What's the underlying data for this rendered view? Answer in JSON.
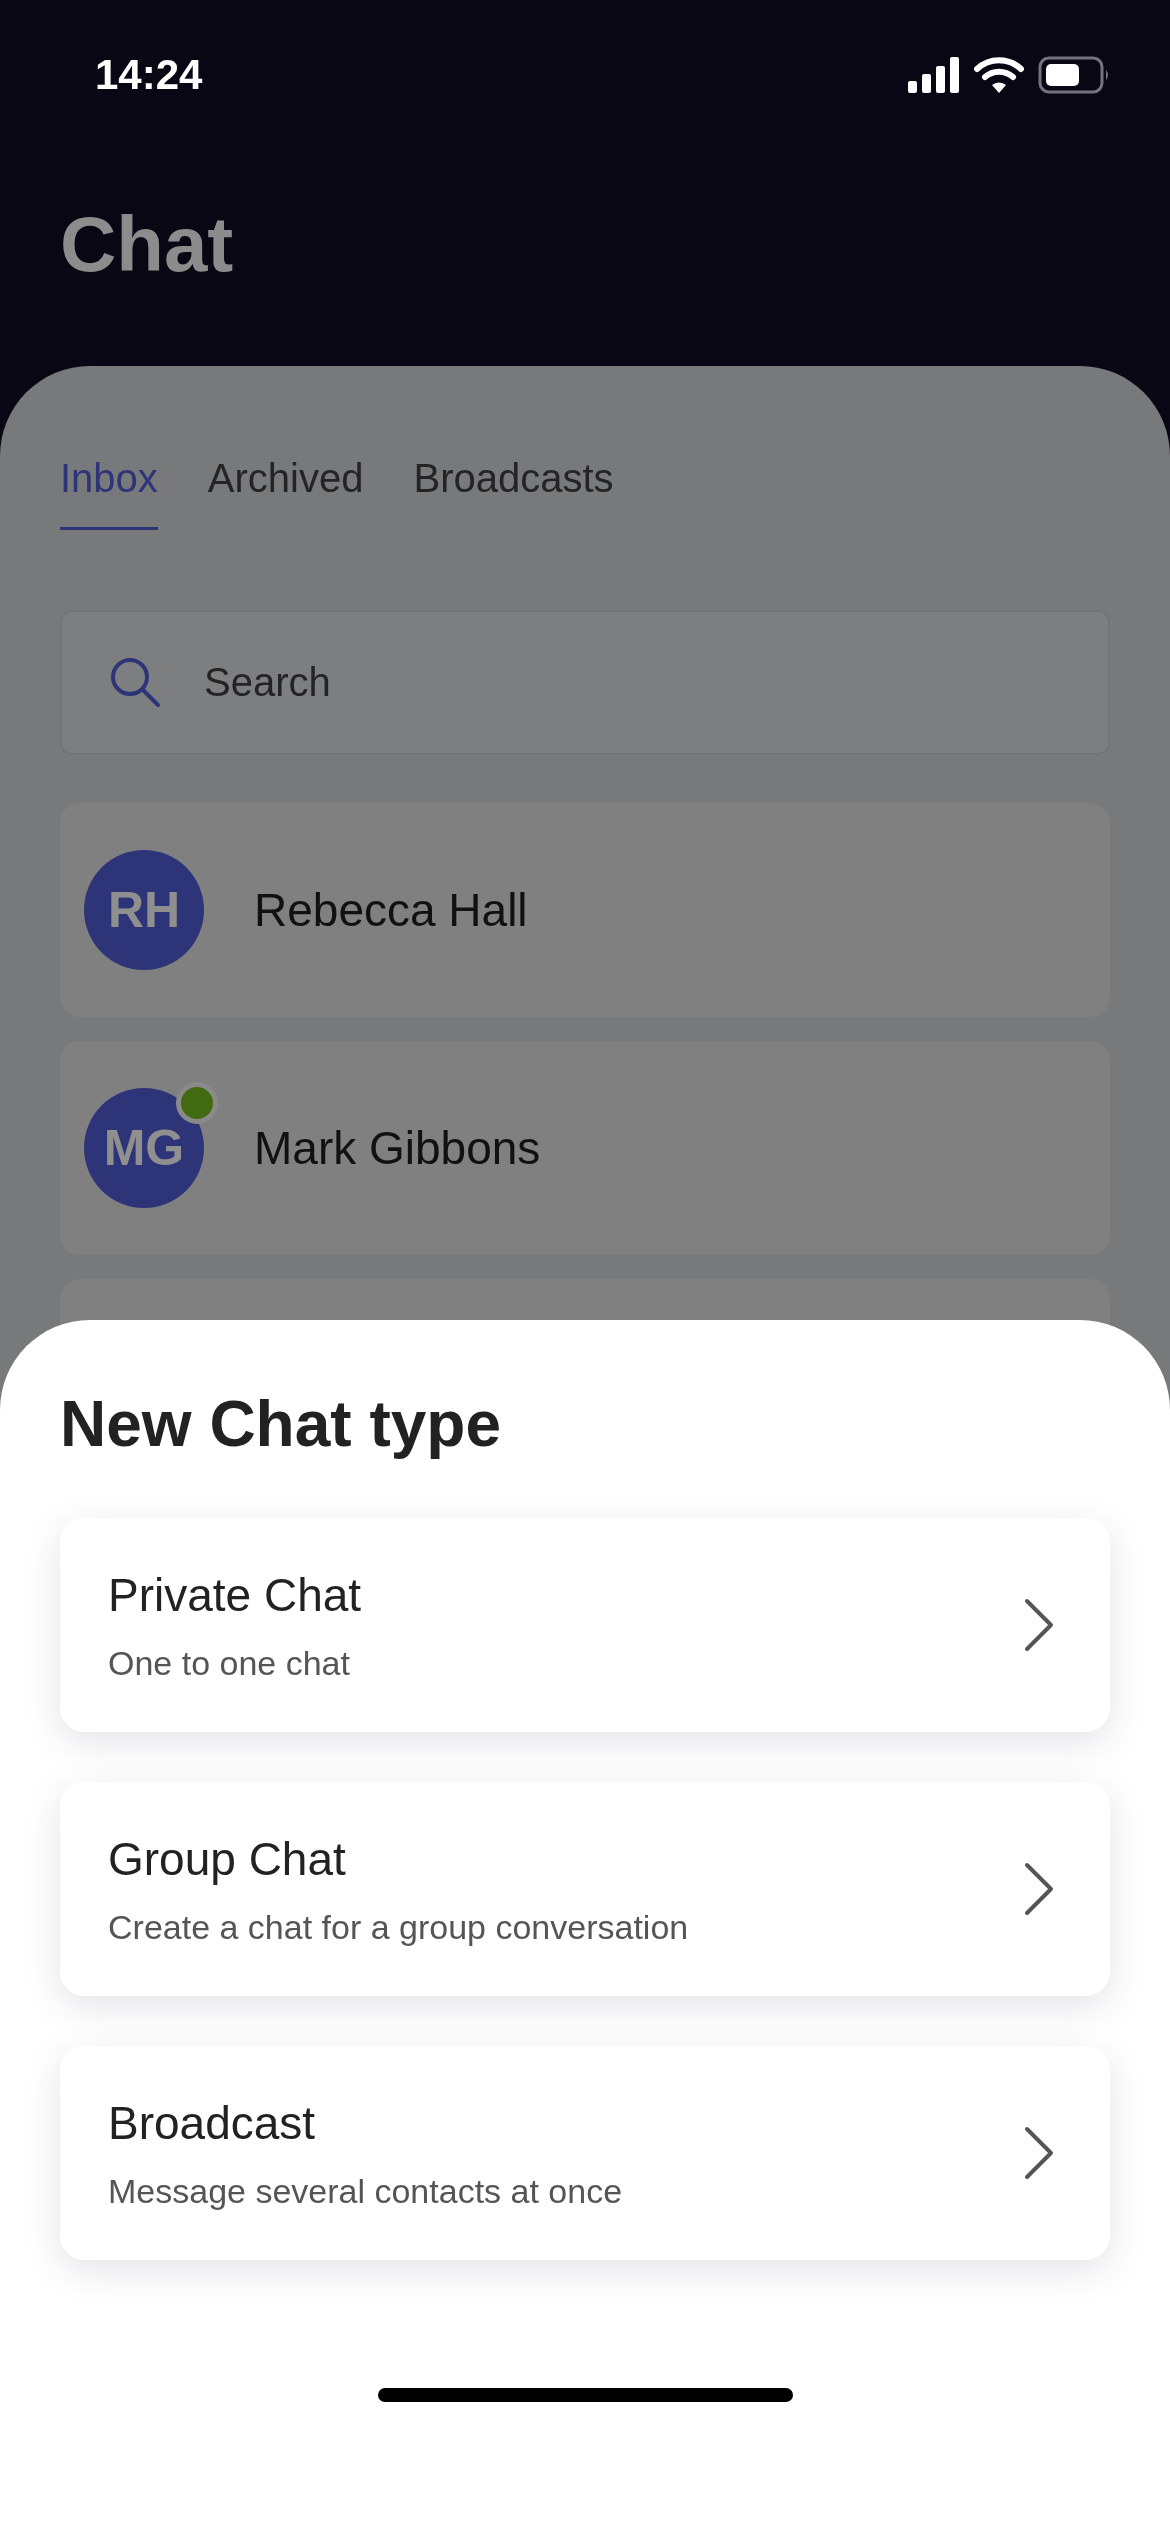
{
  "status_bar": {
    "time": "14:24"
  },
  "header": {
    "title": "Chat"
  },
  "tabs": [
    {
      "label": "Inbox",
      "selected": true
    },
    {
      "label": "Archived",
      "selected": false
    },
    {
      "label": "Broadcasts",
      "selected": false
    }
  ],
  "search": {
    "placeholder": "Search"
  },
  "chats": [
    {
      "initials": "RH",
      "name": "Rebecca Hall",
      "online": false
    },
    {
      "initials": "MG",
      "name": "Mark Gibbons",
      "online": true
    }
  ],
  "sheet": {
    "title": "New Chat type",
    "options": [
      {
        "title": "Private Chat",
        "subtitle": "One to one chat"
      },
      {
        "title": "Group Chat",
        "subtitle": "Create a chat for a group conversation"
      },
      {
        "title": "Broadcast",
        "subtitle": "Message several contacts at once"
      }
    ]
  }
}
